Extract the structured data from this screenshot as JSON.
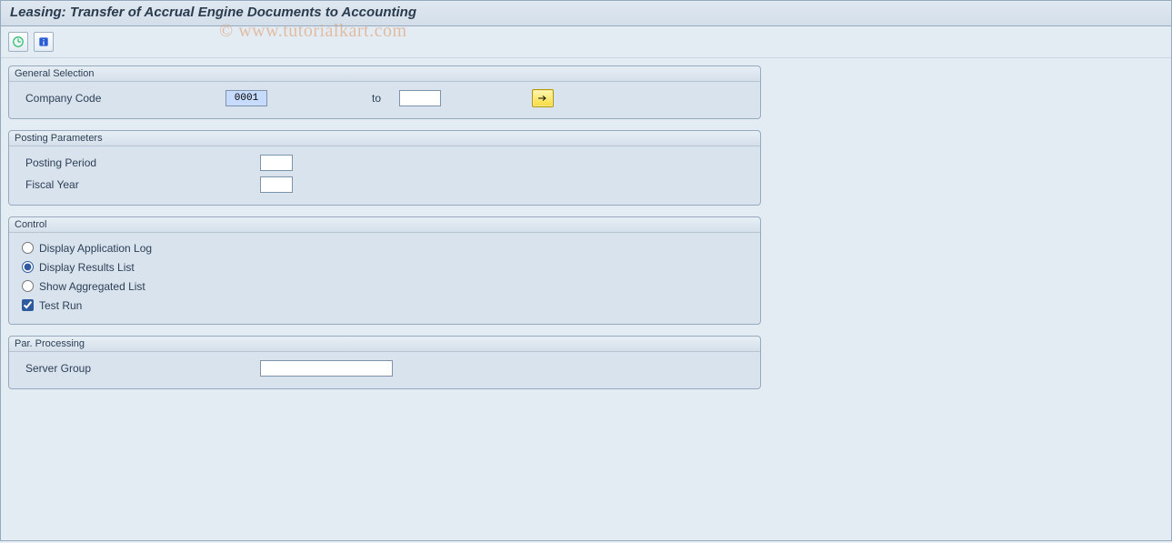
{
  "page_title": "Leasing: Transfer of Accrual Engine Documents to Accounting",
  "watermark": "© www.tutorialkart.com",
  "groups": {
    "general_selection": {
      "title": "General Selection",
      "company_code_label": "Company Code",
      "company_code_from": "0001",
      "to_label": "to",
      "company_code_to": ""
    },
    "posting_parameters": {
      "title": "Posting Parameters",
      "posting_period_label": "Posting Period",
      "posting_period": "",
      "fiscal_year_label": "Fiscal Year",
      "fiscal_year": ""
    },
    "control": {
      "title": "Control",
      "opt_app_log": "Display Application Log",
      "opt_results": "Display Results List",
      "opt_aggregated": "Show Aggregated List",
      "test_run": "Test Run"
    },
    "par_processing": {
      "title": "Par. Processing",
      "server_group_label": "Server Group",
      "server_group": ""
    }
  }
}
